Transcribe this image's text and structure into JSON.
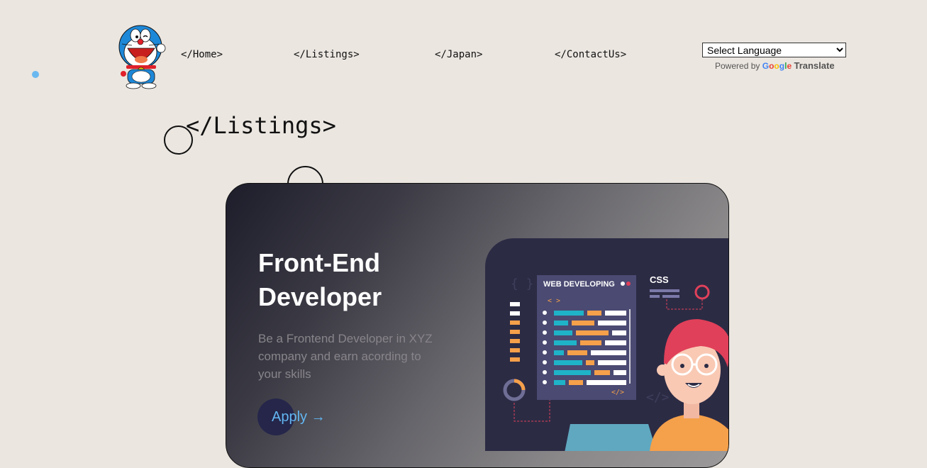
{
  "header": {
    "nav": [
      {
        "label": "</Home>"
      },
      {
        "label": "</Listings>"
      },
      {
        "label": "</Japan>"
      },
      {
        "label": "</ContactUs>"
      }
    ],
    "language_select": {
      "selected": "Select Language"
    },
    "powered_by": "Powered by",
    "google": "Google",
    "translate": "Translate"
  },
  "page": {
    "title": "</Listings>"
  },
  "listing": {
    "title": "Front-End Developer",
    "description": "Be a Frontend Developer in XYZ company and earn acording to your skills",
    "apply_label": "Apply",
    "apply_arrow": "→",
    "illustration": {
      "panel_title": "WEB DEVELOPING",
      "css_label": "CSS",
      "angle_tag": "< >",
      "close_tag": "</>",
      "braces": "{ }",
      "ghost_tag": "</>"
    }
  },
  "colors": {
    "background": "#ebe6e0",
    "accent": "#63b6f3",
    "button": "#25264a",
    "illustration_bg": "#2c2b44",
    "panel": "#4a4a72",
    "cyan": "#1fb3c8",
    "orange": "#f5a04a",
    "pink": "#e0405a"
  }
}
